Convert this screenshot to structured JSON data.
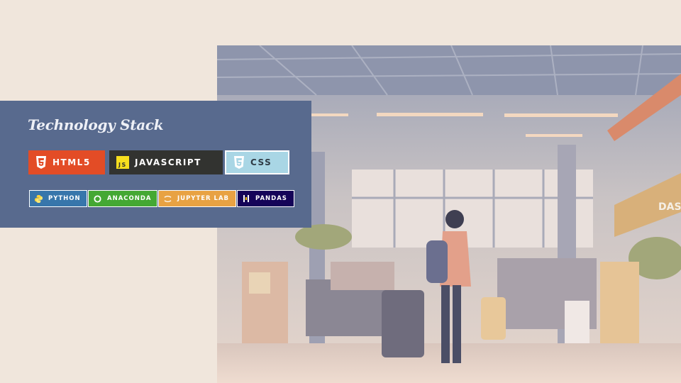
{
  "panel": {
    "title": "Technology Stack"
  },
  "badges_primary": [
    {
      "label": "HTML5",
      "icon": "html5-icon",
      "color": "#e34c26"
    },
    {
      "label": "JAVASCRIPT",
      "icon": "javascript-icon",
      "color": "#323330"
    },
    {
      "label": "CSS",
      "icon": "css3-icon",
      "color": "#a9d6e5"
    }
  ],
  "badges_secondary": [
    {
      "label": "PYTHON",
      "icon": "python-icon",
      "color": "#3776ab"
    },
    {
      "label": "ANACONDA",
      "icon": "anaconda-icon",
      "color": "#44a833"
    },
    {
      "label": "JUPYTER LAB",
      "icon": "jupyter-icon",
      "color": "#e8a243"
    },
    {
      "label": "PANDAS",
      "icon": "pandas-icon",
      "color": "#150458"
    }
  ],
  "scene": {
    "sign_text": "DAS",
    "image": "airport-terminal-traveler-illustration"
  },
  "colors": {
    "background": "#f0e6dc",
    "panel": "#586a8e"
  }
}
